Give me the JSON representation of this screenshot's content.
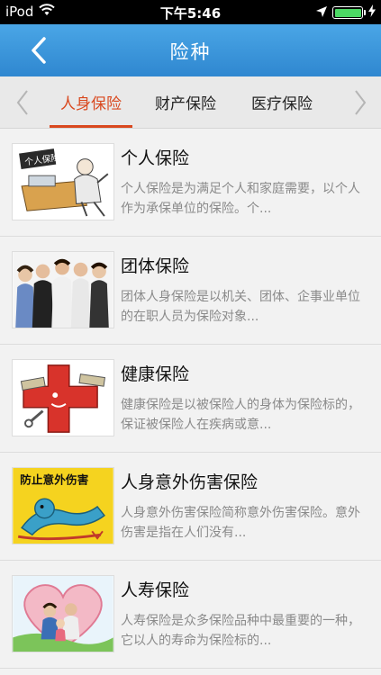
{
  "status_bar": {
    "carrier": "iPod",
    "time": "下午5:46",
    "icons": [
      "wifi-icon",
      "location-arrow-icon",
      "battery-icon",
      "charging-bolt-icon"
    ],
    "battery_color": "#4cd964"
  },
  "nav": {
    "title": "险种",
    "back_icon": "chevron-left-icon",
    "bar_color": "#3a96dc"
  },
  "tabs": {
    "items": [
      {
        "label": "人身保险",
        "active": true
      },
      {
        "label": "财产保险",
        "active": false
      },
      {
        "label": "医疗保险",
        "active": false
      }
    ],
    "accent_color": "#d9481e"
  },
  "list": {
    "items": [
      {
        "title": "个人保险",
        "desc": "个人保险是为满足个人和家庭需要，以个人作为承保单位的保险。个...",
        "thumb_label": "个人保险",
        "thumb_icon": "office-worker-illustration"
      },
      {
        "title": "团体保险",
        "desc": "团体人身保险是以机关、团体、企事业单位的在职人员为保险对象...",
        "thumb_icon": "group-photo"
      },
      {
        "title": "健康保险",
        "desc": "健康保险是以被保险人的身体为保险标的，保证被保险人在疾病或意...",
        "thumb_icon": "red-cross-illustration"
      },
      {
        "title": "人身意外伤害保险",
        "desc": "人身意外伤害保险简称意外伤害保险。意外伤害是指在人们没有...",
        "thumb_label": "防止意外伤害",
        "thumb_icon": "fallen-person-illustration"
      },
      {
        "title": "人寿保险",
        "desc": "人寿保险是众多保险品种中最重要的一种，它以人的寿命为保险标的...",
        "thumb_icon": "family-heart-photo"
      }
    ]
  }
}
